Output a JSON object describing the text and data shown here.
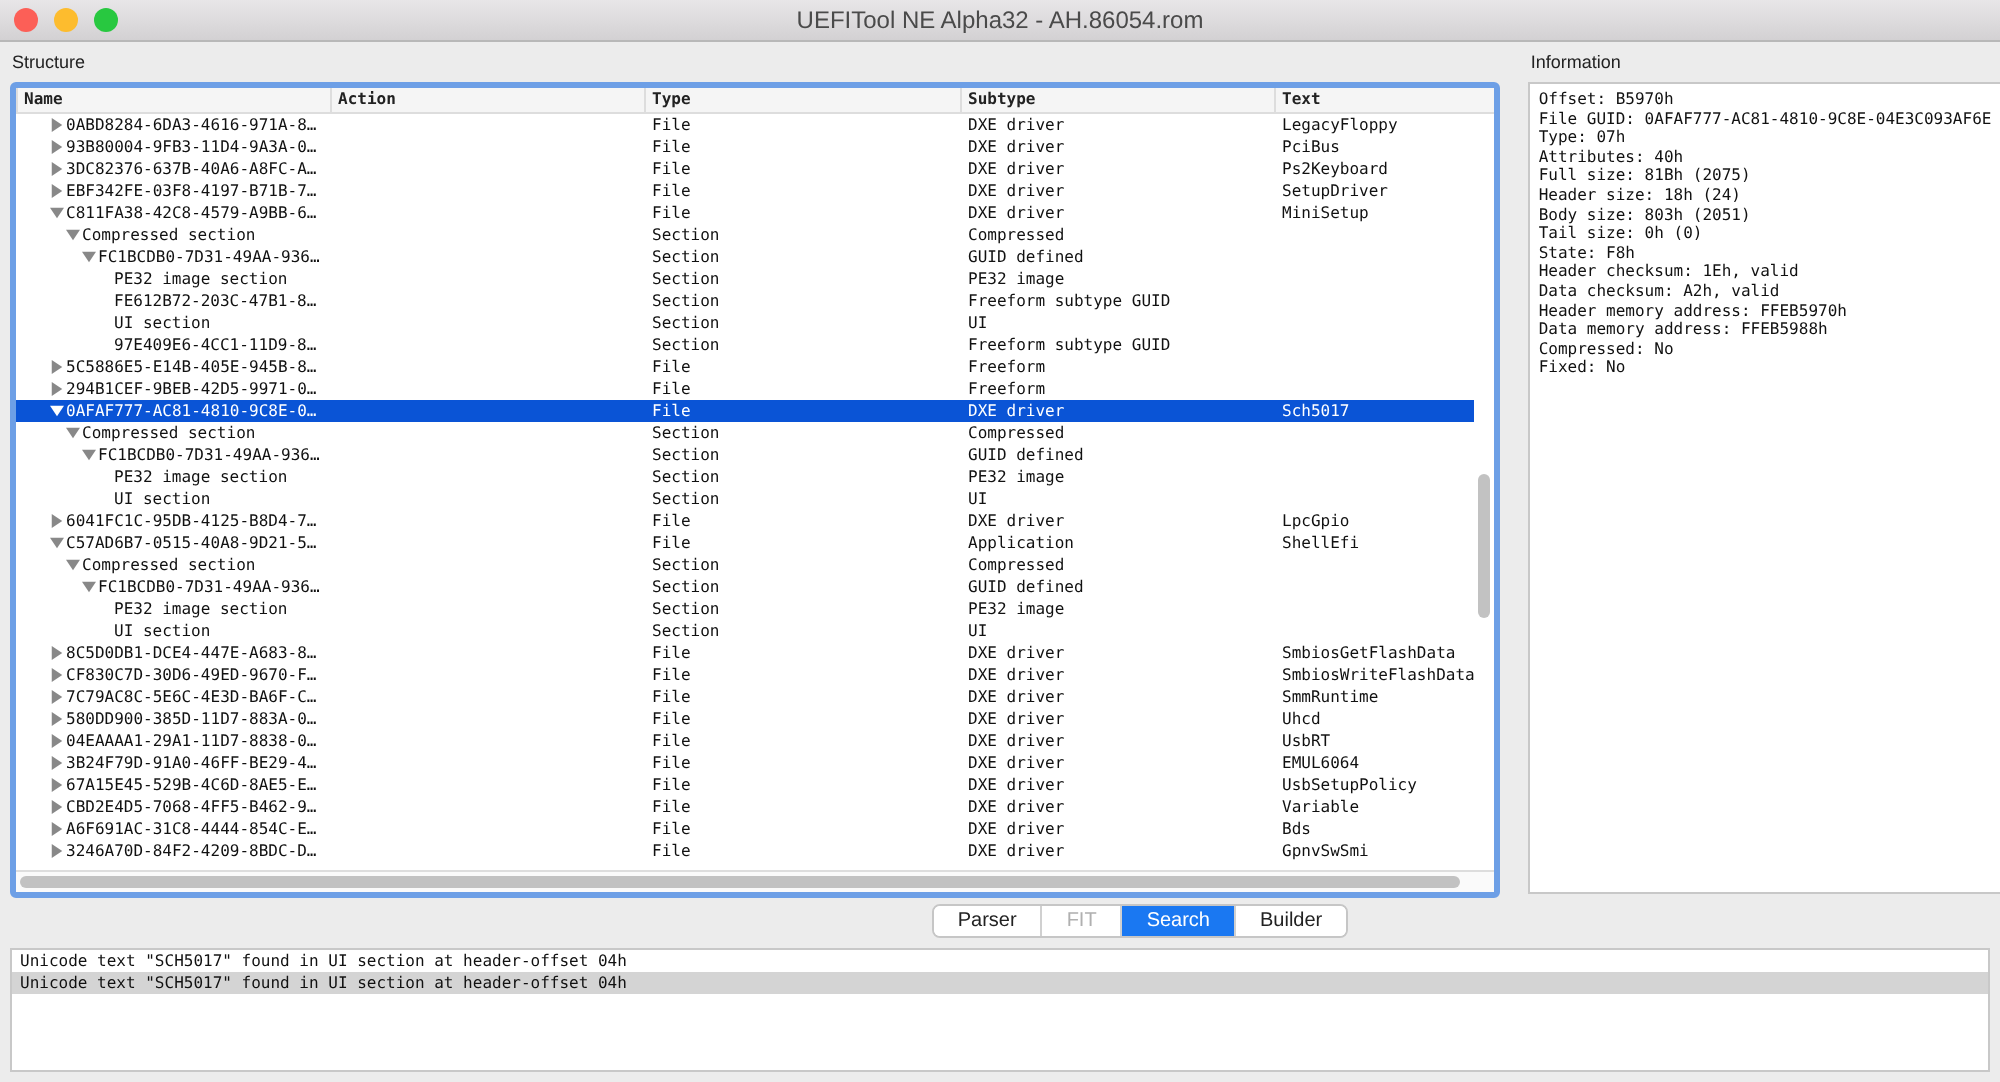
{
  "window": {
    "title": "UEFITool NE Alpha32 - AH.86054.rom"
  },
  "structure": {
    "label": "Structure",
    "columns": [
      "Name",
      "Action",
      "Type",
      "Subtype",
      "Text"
    ],
    "tree": [
      {
        "name": "0ABD8284-6DA3-4616-971A-8…",
        "type": "File",
        "subtype": "DXE driver",
        "text": "LegacyFloppy",
        "expanded": false,
        "selected": false
      },
      {
        "name": "93B80004-9FB3-11D4-9A3A-0…",
        "type": "File",
        "subtype": "DXE driver",
        "text": "PciBus",
        "expanded": false,
        "selected": false
      },
      {
        "name": "3DC82376-637B-40A6-A8FC-A…",
        "type": "File",
        "subtype": "DXE driver",
        "text": "Ps2Keyboard",
        "expanded": false,
        "selected": false
      },
      {
        "name": "EBF342FE-03F8-4197-B71B-7…",
        "type": "File",
        "subtype": "DXE driver",
        "text": "SetupDriver",
        "expanded": false,
        "selected": false
      },
      {
        "name": "C811FA38-42C8-4579-A9BB-6…",
        "type": "File",
        "subtype": "DXE driver",
        "text": "MiniSetup",
        "expanded": true,
        "selected": false,
        "children": [
          {
            "name": "Compressed section",
            "type": "Section",
            "subtype": "Compressed",
            "expanded": true,
            "selected": false,
            "children": [
              {
                "name": "FC1BCDB0-7D31-49AA-936…",
                "type": "Section",
                "subtype": "GUID defined",
                "expanded": true,
                "selected": false,
                "children": [
                  {
                    "name": "PE32 image section",
                    "type": "Section",
                    "subtype": "PE32 image",
                    "selected": false
                  },
                  {
                    "name": "FE612B72-203C-47B1-8…",
                    "type": "Section",
                    "subtype": "Freeform subtype GUID",
                    "selected": false
                  },
                  {
                    "name": "UI section",
                    "type": "Section",
                    "subtype": "UI",
                    "selected": false
                  },
                  {
                    "name": "97E409E6-4CC1-11D9-8…",
                    "type": "Section",
                    "subtype": "Freeform subtype GUID",
                    "selected": false
                  }
                ]
              }
            ]
          }
        ]
      },
      {
        "name": "5C5886E5-E14B-405E-945B-8…",
        "type": "File",
        "subtype": "Freeform",
        "expanded": false,
        "selected": false
      },
      {
        "name": "294B1CEF-9BEB-42D5-9971-0…",
        "type": "File",
        "subtype": "Freeform",
        "expanded": false,
        "selected": false
      },
      {
        "name": "0AFAF777-AC81-4810-9C8E-0…",
        "type": "File",
        "subtype": "DXE driver",
        "text": "Sch5017",
        "expanded": true,
        "selected": true,
        "children": [
          {
            "name": "Compressed section",
            "type": "Section",
            "subtype": "Compressed",
            "expanded": true,
            "selected": false,
            "children": [
              {
                "name": "FC1BCDB0-7D31-49AA-936…",
                "type": "Section",
                "subtype": "GUID defined",
                "expanded": true,
                "selected": false,
                "children": [
                  {
                    "name": "PE32 image section",
                    "type": "Section",
                    "subtype": "PE32 image",
                    "selected": false
                  },
                  {
                    "name": "UI section",
                    "type": "Section",
                    "subtype": "UI",
                    "selected": false
                  }
                ]
              }
            ]
          }
        ]
      },
      {
        "name": "6041FC1C-95DB-4125-B8D4-7…",
        "type": "File",
        "subtype": "DXE driver",
        "text": "LpcGpio",
        "expanded": false,
        "selected": false
      },
      {
        "name": "C57AD6B7-0515-40A8-9D21-5…",
        "type": "File",
        "subtype": "Application",
        "text": "ShellEfi",
        "expanded": true,
        "selected": false,
        "children": [
          {
            "name": "Compressed section",
            "type": "Section",
            "subtype": "Compressed",
            "expanded": true,
            "selected": false,
            "children": [
              {
                "name": "FC1BCDB0-7D31-49AA-936…",
                "type": "Section",
                "subtype": "GUID defined",
                "expanded": true,
                "selected": false,
                "children": [
                  {
                    "name": "PE32 image section",
                    "type": "Section",
                    "subtype": "PE32 image",
                    "selected": false
                  },
                  {
                    "name": "UI section",
                    "type": "Section",
                    "subtype": "UI",
                    "selected": false
                  }
                ]
              }
            ]
          }
        ]
      },
      {
        "name": "8C5D0DB1-DCE4-447E-A683-8…",
        "type": "File",
        "subtype": "DXE driver",
        "text": "SmbiosGetFlashData",
        "expanded": false,
        "selected": false
      },
      {
        "name": "CF830C7D-30D6-49ED-9670-F…",
        "type": "File",
        "subtype": "DXE driver",
        "text": "SmbiosWriteFlashData",
        "expanded": false,
        "selected": false
      },
      {
        "name": "7C79AC8C-5E6C-4E3D-BA6F-C…",
        "type": "File",
        "subtype": "DXE driver",
        "text": "SmmRuntime",
        "expanded": false,
        "selected": false
      },
      {
        "name": "580DD900-385D-11D7-883A-0…",
        "type": "File",
        "subtype": "DXE driver",
        "text": "Uhcd",
        "expanded": false,
        "selected": false
      },
      {
        "name": "04EAAAA1-29A1-11D7-8838-0…",
        "type": "File",
        "subtype": "DXE driver",
        "text": "UsbRT",
        "expanded": false,
        "selected": false
      },
      {
        "name": "3B24F79D-91A0-46FF-BE29-4…",
        "type": "File",
        "subtype": "DXE driver",
        "text": "EMUL6064",
        "expanded": false,
        "selected": false
      },
      {
        "name": "67A15E45-529B-4C6D-8AE5-E…",
        "type": "File",
        "subtype": "DXE driver",
        "text": "UsbSetupPolicy",
        "expanded": false,
        "selected": false
      },
      {
        "name": "CBD2E4D5-7068-4FF5-B462-9…",
        "type": "File",
        "subtype": "DXE driver",
        "text": "Variable",
        "expanded": false,
        "selected": false
      },
      {
        "name": "A6F691AC-31C8-4444-854C-E…",
        "type": "File",
        "subtype": "DXE driver",
        "text": "Bds",
        "expanded": false,
        "selected": false
      },
      {
        "name": "3246A70D-84F2-4209-8BDC-D…",
        "type": "File",
        "subtype": "DXE driver",
        "text": "GpnvSwSmi",
        "expanded": false,
        "selected": false
      }
    ]
  },
  "information": {
    "label": "Information",
    "lines": [
      "Offset: B5970h",
      "File GUID: 0AFAF777-AC81-4810-9C8E-04E3C093AF6E",
      "Type: 07h",
      "Attributes: 40h",
      "Full size: 81Bh (2075)",
      "Header size: 18h (24)",
      "Body size: 803h (2051)",
      "Tail size: 0h (0)",
      "State: F8h",
      "Header checksum: 1Eh, valid",
      "Data checksum: A2h, valid",
      "Header memory address: FFEB5970h",
      "Data memory address: FFEB5988h",
      "Compressed: No",
      "Fixed: No"
    ]
  },
  "tabs": [
    {
      "label": "Parser",
      "selected": false,
      "disabled": false
    },
    {
      "label": "FIT",
      "selected": false,
      "disabled": true
    },
    {
      "label": "Search",
      "selected": true,
      "disabled": false
    },
    {
      "label": "Builder",
      "selected": false,
      "disabled": false
    }
  ],
  "messages": [
    {
      "text": "Unicode text \"SCH5017\" found in UI section at header-offset 04h",
      "selected": false
    },
    {
      "text": "Unicode text \"SCH5017\" found in UI section at header-offset 04h",
      "selected": true
    }
  ]
}
